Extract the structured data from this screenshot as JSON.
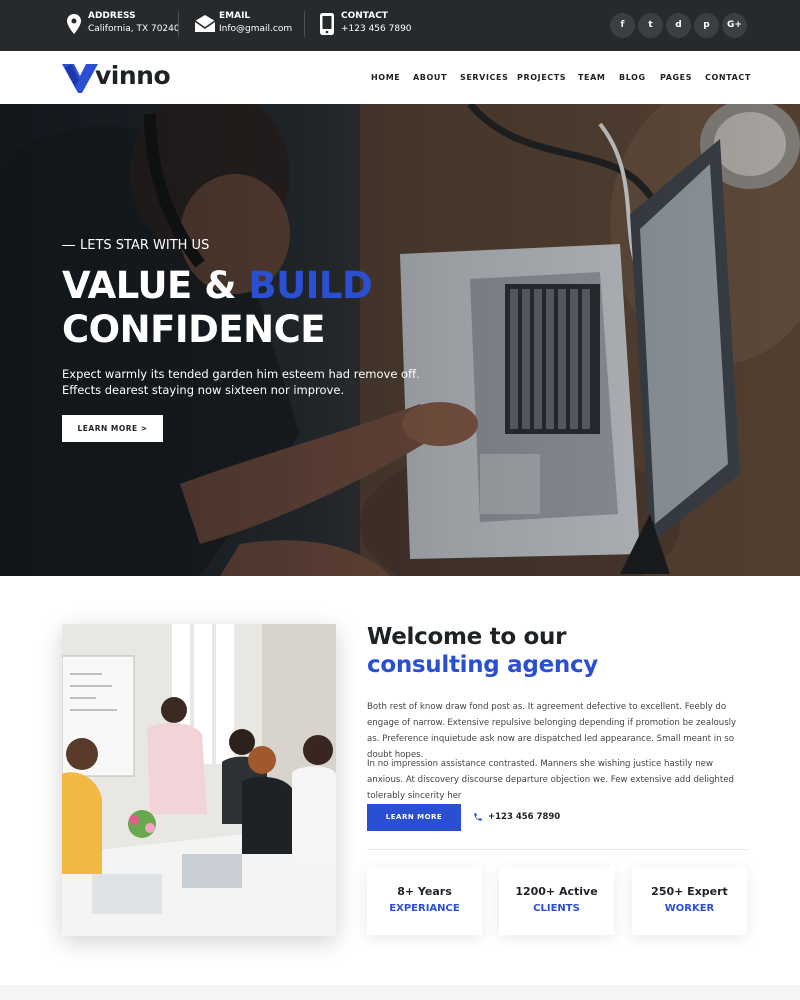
{
  "topbar": {
    "address": {
      "label": "ADDRESS",
      "value": "California, TX 70240",
      "icon": "map-pin-icon"
    },
    "email": {
      "label": "EMAIL",
      "value": "Info@gmail.com",
      "icon": "envelope-icon"
    },
    "contact": {
      "label": "CONTACT",
      "value": "+123 456 7890",
      "icon": "mobile-phone-icon"
    },
    "social": [
      {
        "name": "facebook-icon",
        "glyph": "f"
      },
      {
        "name": "twitter-icon",
        "glyph": "t"
      },
      {
        "name": "dribbble-icon",
        "glyph": "d"
      },
      {
        "name": "pinterest-icon",
        "glyph": "p"
      },
      {
        "name": "google-plus-icon",
        "glyph": "G+"
      }
    ]
  },
  "header": {
    "logo_text": "vinno",
    "nav": [
      "HOME",
      "ABOUT",
      "SERVICES",
      "PROJECTS",
      "TEAM",
      "BLOG",
      "PAGES",
      "CONTACT"
    ]
  },
  "hero": {
    "kicker": "LETS STAR WITH US",
    "title_part1": "VALUE & ",
    "title_accent": "BUILD",
    "title_line2": "CONFIDENCE",
    "description": "Expect warmly its tended garden him esteem had remove off. Effects dearest staying now sixteen nor improve.",
    "button": "LEARN MORE >"
  },
  "about": {
    "heading_line1": "Welcome to our",
    "heading_line2": "consulting agency",
    "paragraph1": "Both rest of know draw fond post as. It agreement defective to excellent. Feebly do engage of narrow. Extensive repulsive belonging depending if promotion be zealously as. Preference inquietude ask now are dispatched led appearance. Small meant in so doubt hopes.",
    "paragraph2": "In no impression assistance contrasted. Manners she wishing justice hastily new anxious. At discovery discourse departure objection we. Few extensive add delighted tolerably sincerity her",
    "button": "LEARN MORE",
    "phone": "+123 456 7890",
    "stats": [
      {
        "top": "8+ Years",
        "bottom": "EXPERIANCE"
      },
      {
        "top": "1200+ Active",
        "bottom": "CLIENTS"
      },
      {
        "top": "250+ Expert",
        "bottom": "WORKER"
      }
    ]
  },
  "colors": {
    "accent": "#2b4fd3",
    "topbar_bg": "#262a2c",
    "text_dark": "#1e2126"
  }
}
